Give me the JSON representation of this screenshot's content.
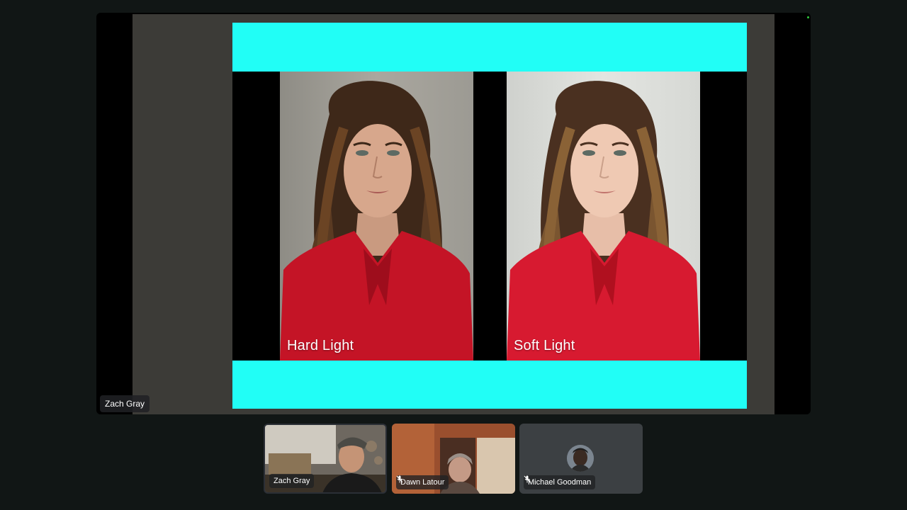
{
  "presentation": {
    "slide_colors": {
      "band": "#21fef6",
      "body": "#000000"
    },
    "photos": [
      {
        "label": "Hard Light"
      },
      {
        "label": "Soft Light"
      }
    ]
  },
  "active_speaker": {
    "name": "Zach Gray"
  },
  "participants": [
    {
      "name": "Zach Gray",
      "muted": false,
      "video": true
    },
    {
      "name": "Dawn Latour",
      "muted": true,
      "video": true
    },
    {
      "name": "Michael Goodman",
      "muted": true,
      "video": false
    }
  ],
  "colors": {
    "background": "#111615",
    "tile": "#3c4043",
    "recording_dot": "#2ec83c"
  },
  "icons": {
    "muted": "mic-off-icon"
  }
}
